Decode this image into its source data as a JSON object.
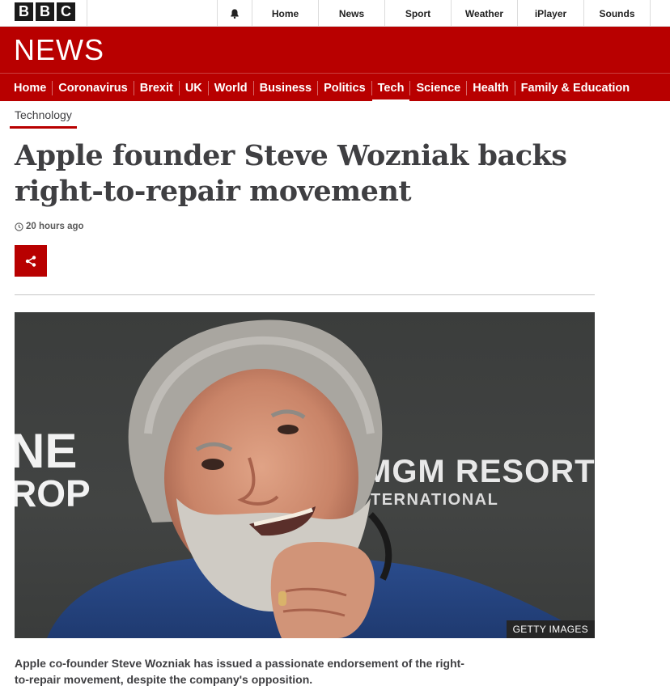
{
  "brand": {
    "letters": [
      "B",
      "B",
      "C"
    ]
  },
  "top_nav": {
    "items": [
      "Home",
      "News",
      "Sport",
      "Weather",
      "iPlayer",
      "Sounds"
    ]
  },
  "header": {
    "title": "NEWS"
  },
  "sections": {
    "items": [
      "Home",
      "Coronavirus",
      "Brexit",
      "UK",
      "World",
      "Business",
      "Politics",
      "Tech",
      "Science",
      "Health",
      "Family & Education"
    ],
    "active": "Tech"
  },
  "breadcrumb": "Technology",
  "article": {
    "headline": "Apple founder Steve Wozniak backs right-to-repair movement",
    "timestamp": "20 hours ago",
    "image": {
      "credit": "GETTY IMAGES",
      "backdrop_text_left_1": "NE",
      "backdrop_text_left_2": "ROP",
      "backdrop_text_right_1": "MGM RESORTS",
      "backdrop_text_right_2": "TERNATIONAL"
    },
    "summary": "Apple co-founder Steve Wozniak has issued a passionate endorsement of the right-to-repair movement, despite the company's opposition."
  },
  "colors": {
    "brand_red": "#b80000",
    "text": "#3f3f42"
  },
  "icons": {
    "bell": "bell-icon",
    "clock": "clock-icon",
    "share": "share-icon"
  }
}
